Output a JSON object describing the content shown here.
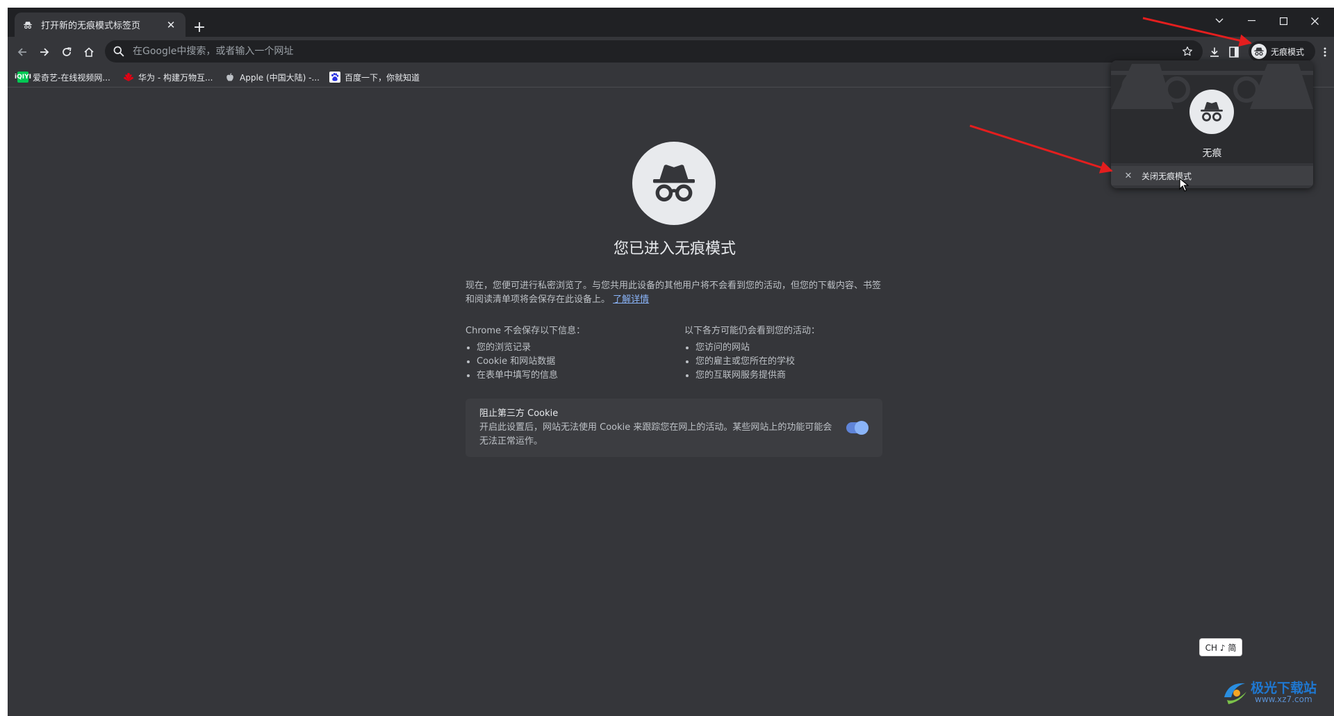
{
  "colors": {
    "frame_dark": "#202124",
    "surface": "#35363a",
    "text_primary": "#e8eaed",
    "text_secondary": "#bdc1c6",
    "link": "#8ab4f8",
    "annotation_arrow": "#e41e1e"
  },
  "tab": {
    "title": "打开新的无痕模式标签页",
    "icon": "incognito-icon",
    "close_icon": "close-icon"
  },
  "window_controls": [
    "chevron-down-icon",
    "minimize-icon",
    "maximize-icon",
    "close-icon"
  ],
  "toolbar": {
    "back_icon": "arrow-left-icon",
    "forward_icon": "arrow-right-icon",
    "reload_icon": "reload-icon",
    "home_icon": "home-icon",
    "omnibox_placeholder": "在Google中搜索，或者输入一个网址",
    "bookmark_star_icon": "star-icon",
    "download_icon": "download-icon",
    "side_panel_icon": "side-panel-icon",
    "incognito_chip_label": "无痕模式",
    "menu_icon": "more-vert-icon"
  },
  "bookmarks": [
    {
      "label": "爱奇艺-在线视频网...",
      "icon": "iqiyi-icon",
      "icon_text": "iQIYI"
    },
    {
      "label": "华为 - 构建万物互...",
      "icon": "huawei-icon"
    },
    {
      "label": "Apple (中国大陆) -...",
      "icon": "apple-icon"
    },
    {
      "label": "百度一下，你就知道",
      "icon": "baidu-icon"
    }
  ],
  "content": {
    "heading": "您已进入无痕模式",
    "intro_text": "现在，您便可进行私密浏览了。与您共用此设备的其他用户将不会看到您的活动，但您的下载内容、书签和阅读清单项将会保存在此设备上。",
    "learn_more": "了解详情",
    "not_saved_title": "Chrome 不会保存以下信息：",
    "not_saved_items": [
      "您的浏览记录",
      "Cookie 和网站数据",
      "在表单中填写的信息"
    ],
    "visible_title": "以下各方可能仍会看到您的活动：",
    "visible_items": [
      "您访问的网站",
      "您的雇主或您所在的学校",
      "您的互联网服务提供商"
    ],
    "cookie_title": "阻止第三方 Cookie",
    "cookie_desc": "开启此设置后，网站无法使用 Cookie 来跟踪您在网上的活动。某些网站上的功能可能会无法正常运作。",
    "cookie_toggle_on": true
  },
  "popup": {
    "profile_name": "无痕",
    "close_label": "关闭无痕模式"
  },
  "ime": {
    "label": "CH ♪ 简"
  },
  "watermark": {
    "title": "极光下载站",
    "subtitle": "www.xz7.com"
  }
}
